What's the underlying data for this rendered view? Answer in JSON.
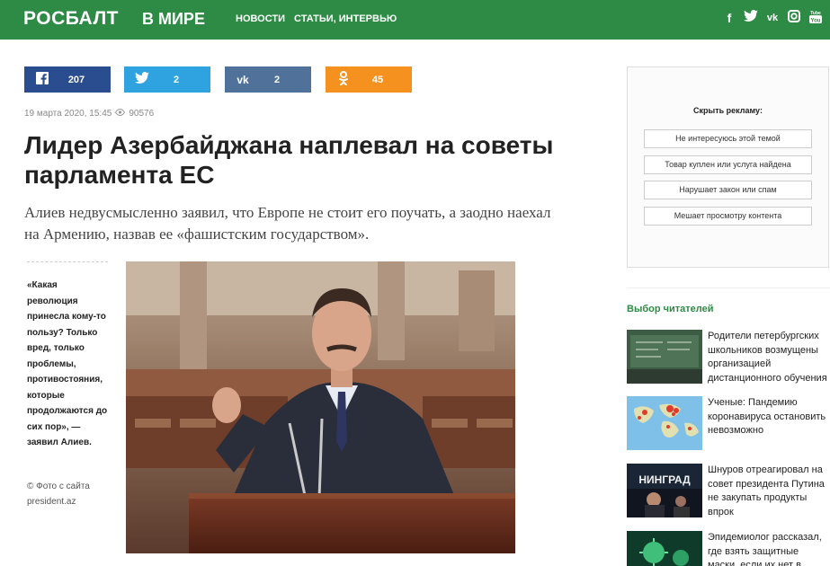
{
  "header": {
    "logo": "РОСБАЛТ",
    "section": "В МИРЕ",
    "nav": [
      "НОВОСТИ",
      "СТАТЬИ, ИНТЕРВЬЮ"
    ],
    "social_icons": [
      "facebook-icon",
      "twitter-icon",
      "vk-icon",
      "instagram-icon",
      "youtube-icon"
    ],
    "color": "#2e8b45"
  },
  "share": {
    "facebook": "207",
    "twitter": "2",
    "vk": "2",
    "ok": "45"
  },
  "article": {
    "date": "19 марта 2020, 15:45",
    "views": "90576",
    "title": "Лидер Азербайджана наплевал на советы парламента ЕС",
    "lead": "Алиев недвусмысленно заявил, что Европе не стоит его поучать, а заодно наехал на Армению, назвав ее «фашистским государством».",
    "quote": "«Какая революция принесла кому-то пользу? Только вред, только проблемы, противостояния, которые продолжаются до сих пор», — заявил Алиев.",
    "photo_credit": "© Фото с сайта president.az"
  },
  "ad": {
    "question": "Скрыть рекламу:",
    "options": [
      "Не интересуюсь этой темой",
      "Товар куплен или услуга найдена",
      "Нарушает закон или спам",
      "Мешает просмотру контента"
    ]
  },
  "readers_choice": {
    "title": "Выбор читателей",
    "items": [
      "Родители петербургских школьников возмущены организацией дистанционного обучения",
      "Ученые: Пандемию коронавируса остановить невозможно",
      "Шнуров отреагировал на совет президента Путина не закупать продукты впрок",
      "Эпидемиолог рассказал, где взять защитные маски, если их нет в аптеке"
    ]
  }
}
